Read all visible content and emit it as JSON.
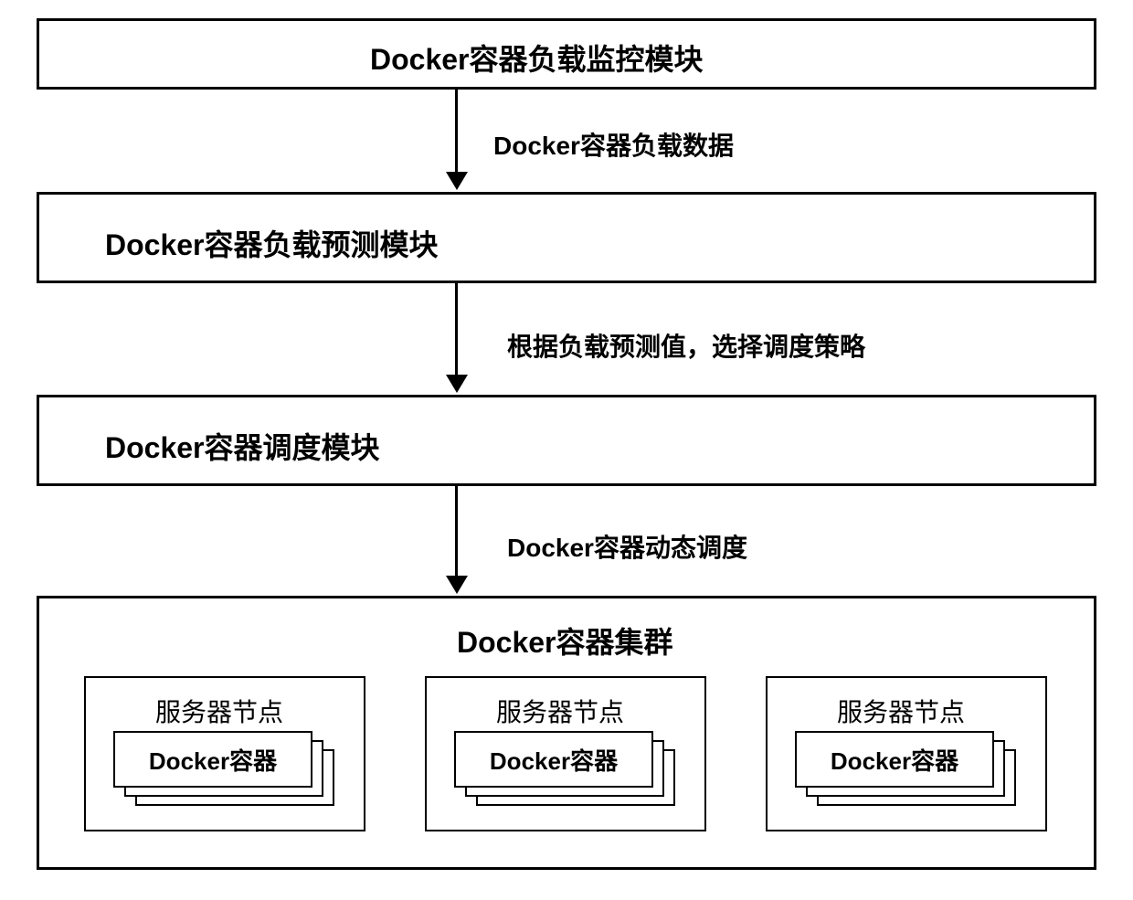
{
  "diagram": {
    "boxes": {
      "monitor": "Docker容器负载监控模块",
      "predict": "Docker容器负载预测模块",
      "schedule": "Docker容器调度模块",
      "cluster_title": "Docker容器集群"
    },
    "arrows": {
      "a1": "Docker容器负载数据",
      "a2": "根据负载预测值，选择调度策略",
      "a3": "Docker容器动态调度"
    },
    "node": {
      "title": "服务器节点",
      "container": "Docker容器"
    }
  }
}
